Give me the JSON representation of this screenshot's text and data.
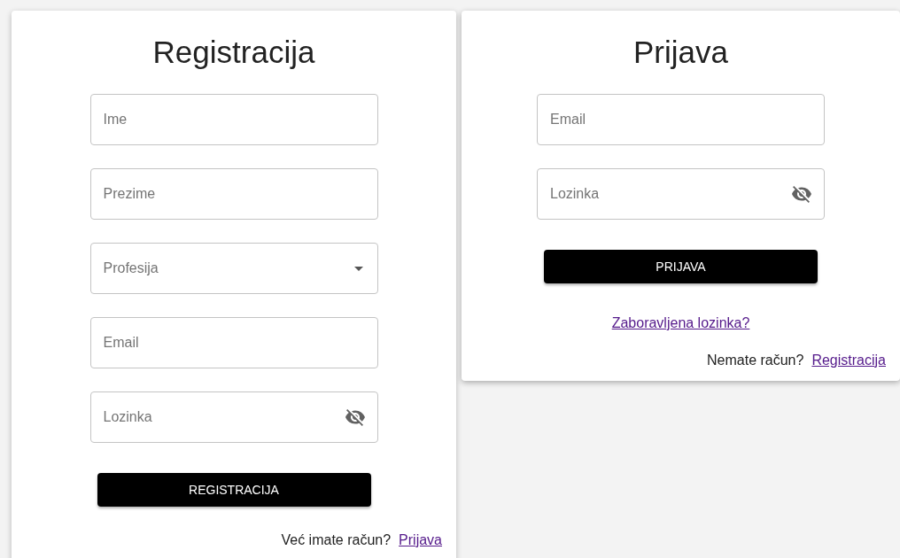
{
  "register": {
    "title": "Registracija",
    "fields": [
      {
        "kind": "text",
        "placeholder": "Ime"
      },
      {
        "kind": "text",
        "placeholder": "Prezime"
      },
      {
        "kind": "select",
        "placeholder": "Profesija"
      },
      {
        "kind": "text",
        "placeholder": "Email"
      },
      {
        "kind": "password",
        "placeholder": "Lozinka"
      }
    ],
    "button": "REGISTRACIJA",
    "footer": {
      "text": "Već imate račun?",
      "link": "Prijava"
    }
  },
  "login": {
    "title": "Prijava",
    "fields": [
      {
        "kind": "text",
        "placeholder": "Email"
      },
      {
        "kind": "password",
        "placeholder": "Lozinka"
      }
    ],
    "button": "PRIJAVA",
    "forgot_link": "Zaboravljena lozinka?",
    "footer": {
      "text": "Nemate račun?",
      "link": "Registracija"
    }
  }
}
